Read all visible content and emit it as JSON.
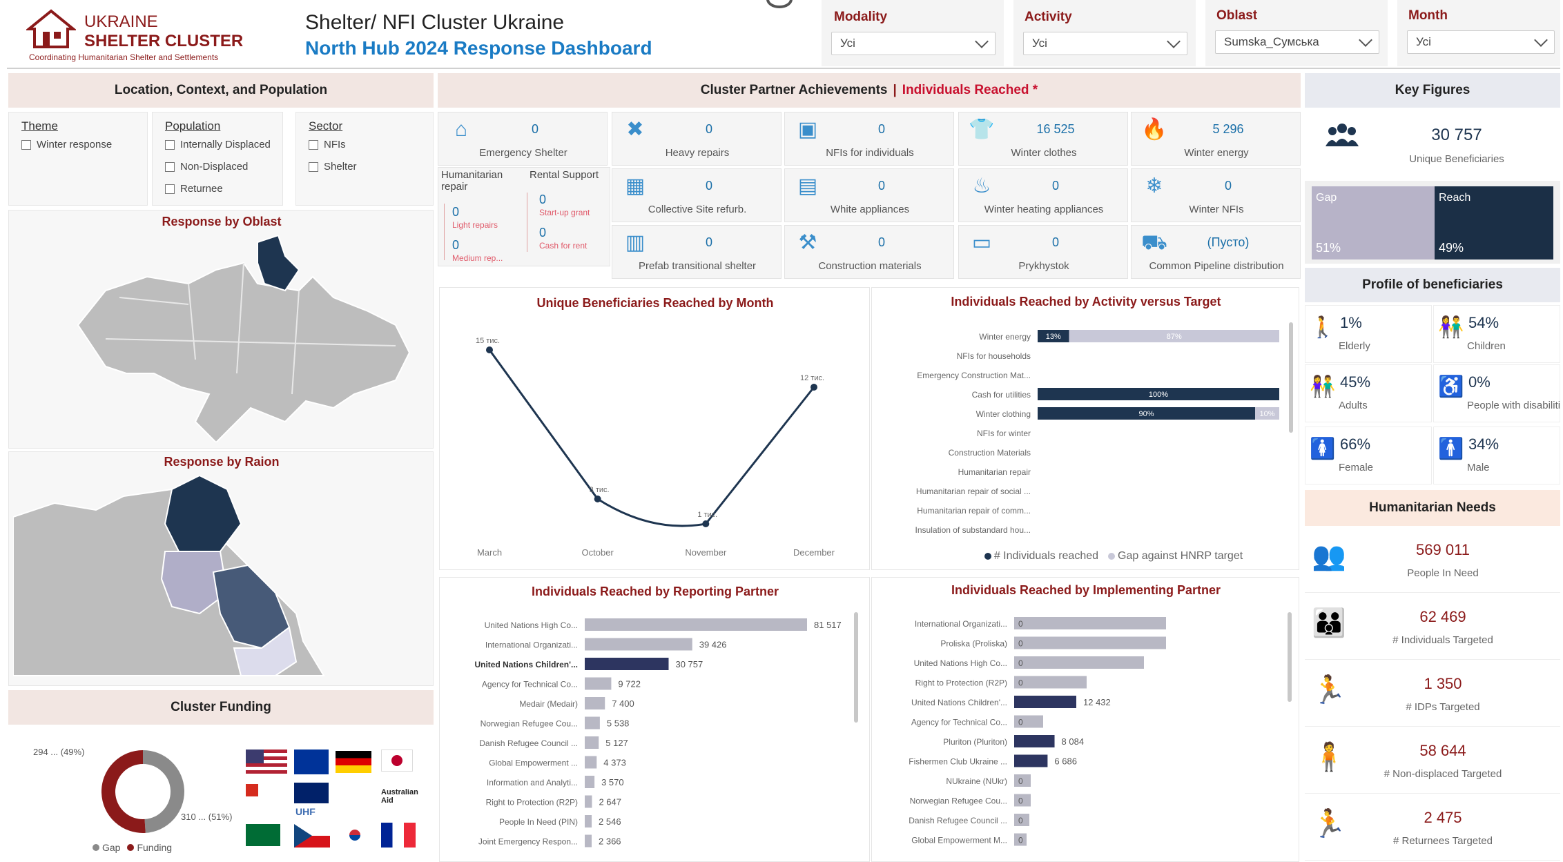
{
  "header": {
    "logo_line1": "UKRAINE",
    "logo_line2": "SHELTER CLUSTER",
    "logo_tag": "Coordinating Humanitarian Shelter and Settlements",
    "title": "Shelter/ NFI Cluster Ukraine",
    "subtitle": "North Hub 2024 Response Dashboard"
  },
  "filters": [
    {
      "label": "Modality",
      "value": "Усі"
    },
    {
      "label": "Activity",
      "value": "Усі"
    },
    {
      "label": "Oblast",
      "value": "Sumska_Сумська"
    },
    {
      "label": "Month",
      "value": "Усі"
    }
  ],
  "location_panel": {
    "title": "Location, Context, and Population",
    "theme": {
      "title": "Theme",
      "items": [
        "Winter response"
      ]
    },
    "population": {
      "title": "Population",
      "items": [
        "Internally Displaced",
        "Non-Displaced",
        "Returnee"
      ]
    },
    "sector": {
      "title": "Sector",
      "items": [
        "NFIs",
        "Shelter"
      ]
    },
    "map_oblast_title": "Response by Oblast",
    "map_raion_title": "Response by Raion",
    "funding_title": "Cluster Funding",
    "funding_gap_label": "294 ... (49%)",
    "funding_fund_label": "310 ... (51%)",
    "funding_legend": [
      "Gap",
      "Funding"
    ]
  },
  "achievements": {
    "title": "Cluster Partner Achievements",
    "title_suffix": "Individuals Reached *",
    "kpis": [
      {
        "icon": "house-shield-icon",
        "value": "0",
        "label": "Emergency Shelter"
      },
      {
        "icon": "tools-icon",
        "value": "0",
        "label": "Heavy repairs"
      },
      {
        "icon": "nfi-box-icon",
        "value": "0",
        "label": "NFIs for individuals"
      },
      {
        "icon": "shirt-icon",
        "value": "16 525",
        "label": "Winter clothes"
      },
      {
        "icon": "flame-icon",
        "value": "5 296",
        "label": "Winter energy"
      },
      {
        "icon": "building-icon",
        "value": "0",
        "label": "Collective Site refurb."
      },
      {
        "icon": "appliance-icon",
        "value": "0",
        "label": "White appliances"
      },
      {
        "icon": "heater-icon",
        "value": "0",
        "label": "Winter heating appliances"
      },
      {
        "icon": "snowflake-icon",
        "value": "0",
        "label": "Winter NFIs"
      },
      {
        "icon": "prefab-icon",
        "value": "0",
        "label": "Prefab transitional shelter"
      },
      {
        "icon": "construction-icon",
        "value": "0",
        "label": "Construction materials"
      },
      {
        "icon": "cash-icon",
        "value": "0",
        "label": "Prykhystok"
      },
      {
        "icon": "truck-icon",
        "value": "(Пусто)",
        "label": "Common Pipeline distribution"
      }
    ],
    "hum_repair": {
      "title": "Humanitarian repair",
      "light_val": "0",
      "light_lbl": "Light repairs",
      "medium_val": "0",
      "medium_lbl": "Medium rep..."
    },
    "rental": {
      "title": "Rental Support",
      "startup_val": "0",
      "startup_lbl": "Start-up grant",
      "cash_val": "0",
      "cash_lbl": "Cash for rent"
    }
  },
  "key_figures": {
    "title": "Key Figures",
    "unique_value": "30 757",
    "unique_label": "Unique Beneficiaries",
    "gap_label": "Gap",
    "gap_pct": "51%",
    "reach_label": "Reach",
    "reach_pct": "49%",
    "reach_fraction": 0.49,
    "profile_title": "Profile of beneficiaries",
    "profile": [
      {
        "icon": "elderly-icon",
        "value": "1%",
        "label": "Elderly"
      },
      {
        "icon": "children-icon",
        "value": "54%",
        "label": "Children"
      },
      {
        "icon": "adults-icon",
        "value": "45%",
        "label": "Adults"
      },
      {
        "icon": "disability-icon",
        "value": "0%",
        "label": "People with disabiliti..."
      },
      {
        "icon": "female-icon",
        "value": "66%",
        "label": "Female"
      },
      {
        "icon": "male-icon",
        "value": "34%",
        "label": "Male"
      }
    ],
    "needs_title": "Humanitarian Needs",
    "needs": [
      {
        "icon": "people-in-need-icon",
        "value": "569 011",
        "label": "People In Need"
      },
      {
        "icon": "targeted-icon",
        "value": "62 469",
        "label": "# Individuals Targeted"
      },
      {
        "icon": "idp-icon",
        "value": "1 350",
        "label": "# IDPs Targeted"
      },
      {
        "icon": "non-displaced-icon",
        "value": "58 644",
        "label": "# Non-displaced Targeted"
      },
      {
        "icon": "returnee-icon",
        "value": "2 475",
        "label": "# Returnees Targeted"
      }
    ]
  },
  "chart_data": [
    {
      "type": "line",
      "title": "Unique Beneficiaries Reached by Month",
      "categories": [
        "March",
        "October",
        "November",
        "December"
      ],
      "values": [
        15000,
        3000,
        1000,
        12000
      ],
      "value_labels": [
        "15 тис.",
        "3 тис.",
        "1 тис.",
        "12 тис."
      ],
      "color": "#1e3550"
    },
    {
      "type": "bar",
      "title": "Individuals Reached by Activity versus Target",
      "categories": [
        "Winter energy",
        "NFIs for households",
        "Emergency Construction Mat...",
        "Cash for utilities",
        "Winter clothing",
        "NFIs for winter",
        "Construction Materials",
        "Humanitarian repair",
        "Humanitarian repair of social ...",
        "Humanitarian repair of comm...",
        "Insulation of substandard hou..."
      ],
      "series": [
        {
          "name": "# Individuals reached",
          "values": [
            13,
            null,
            null,
            100,
            90,
            null,
            null,
            null,
            null,
            null,
            null
          ],
          "color": "#1e3550"
        },
        {
          "name": "Gap against HNRP target",
          "values": [
            87,
            null,
            null,
            0,
            10,
            null,
            null,
            null,
            null,
            null,
            null
          ],
          "color": "#c8c8d8"
        }
      ],
      "data_labels": {
        "Winter energy": [
          "13%",
          "87%"
        ],
        "Cash for utilities": [
          "100%"
        ],
        "Winter clothing": [
          "90%",
          "10%"
        ]
      },
      "legend": "bottom"
    },
    {
      "type": "bar",
      "title": "Individuals Reached by Reporting Partner",
      "categories": [
        "United Nations High Co...",
        "International Organizati...",
        "United Nations Children'...",
        "Agency for Technical Co...",
        "Medair (Medair)",
        "Norwegian Refugee Cou...",
        "Danish Refugee Council ...",
        "Global Empowerment ...",
        "Information and Analyti...",
        "Right to Protection (R2P)",
        "People In Need (PIN)",
        "Joint Emergency Respon..."
      ],
      "values": [
        81517,
        39426,
        30757,
        9722,
        7400,
        5538,
        5127,
        4373,
        3570,
        2647,
        2546,
        2366
      ],
      "value_labels": [
        "81 517",
        "39 426",
        "30 757",
        "9 722",
        "7 400",
        "5 538",
        "5 127",
        "4 373",
        "3 570",
        "2 647",
        "2 546",
        "2 366"
      ],
      "highlight_index": 2
    },
    {
      "type": "bar",
      "title": "Individuals Reached by Implementing Partner",
      "categories": [
        "International Organizati...",
        "Proliska (Proliska)",
        "United Nations High Co...",
        "Right to Protection (R2P)",
        "United Nations Children'...",
        "Agency for Technical Co...",
        "Pluriton (Pluriton)",
        "Fishermen Club Ukraine ...",
        "NUkraine (NUkr)",
        "Norwegian Refugee Cou...",
        "Danish Refugee Council ...",
        "Global Empowerment M..."
      ],
      "values": [
        0,
        0,
        0,
        0,
        12432,
        0,
        8084,
        6686,
        0,
        0,
        0,
        0
      ],
      "value_labels": [
        "0",
        "0",
        "0",
        "0",
        "12 432",
        "0",
        "8 084",
        "6 686",
        "0",
        "0",
        "0",
        "0"
      ],
      "bg_values": [
        220,
        220,
        188,
        105,
        60,
        42,
        38,
        30,
        24,
        24,
        22,
        18
      ]
    },
    {
      "type": "pie",
      "title": "Cluster Funding",
      "categories": [
        "Gap",
        "Funding"
      ],
      "values": [
        49,
        51
      ],
      "colors": [
        "#8a8a8a",
        "#8b1a1a"
      ]
    }
  ]
}
